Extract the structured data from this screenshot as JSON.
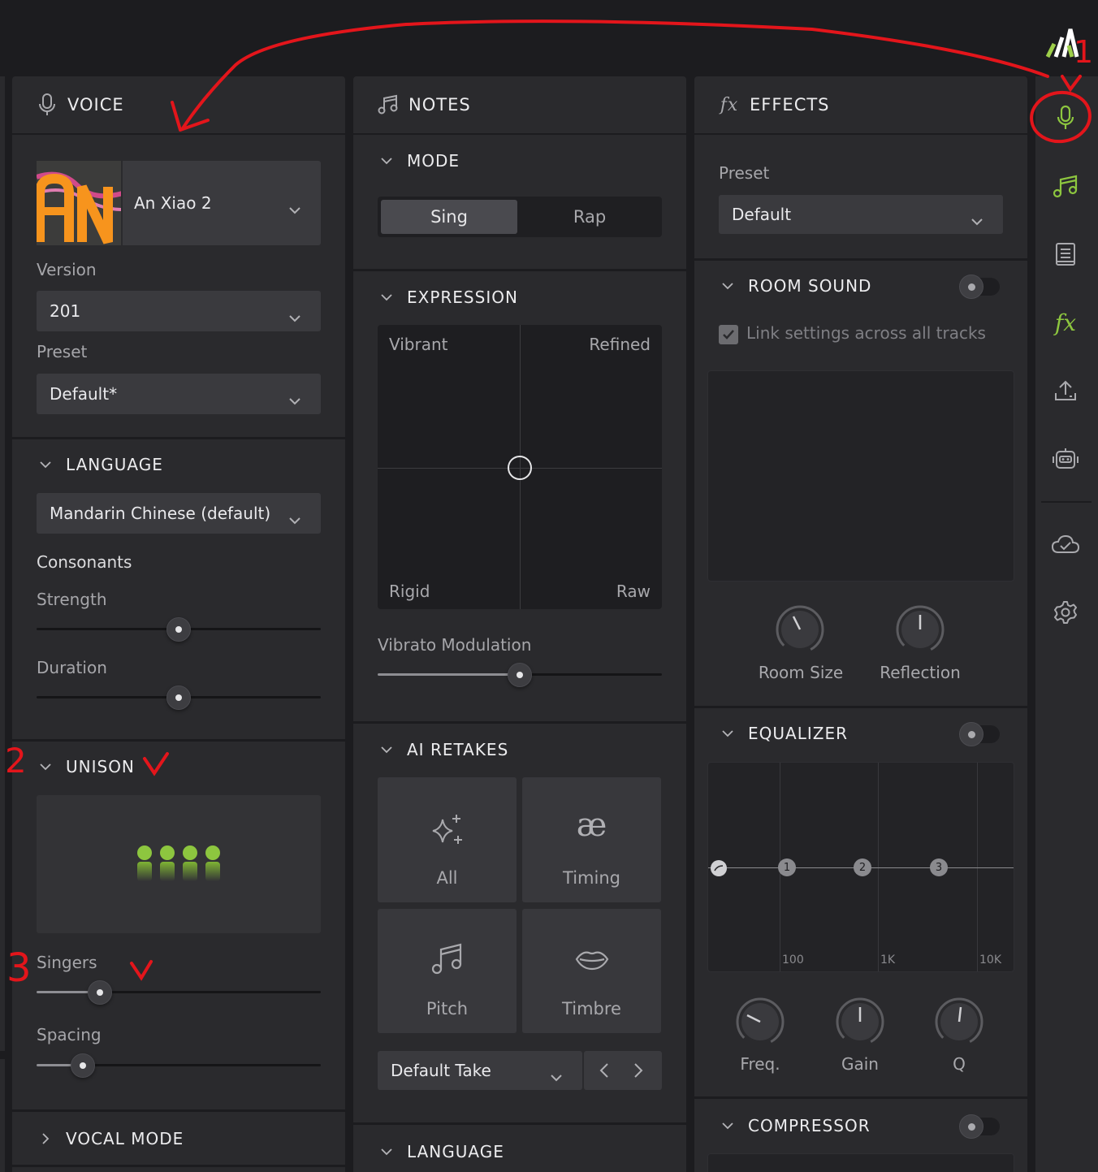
{
  "voice": {
    "header": "VOICE",
    "voice_name": "An Xiao 2",
    "avatar_text": "AN",
    "version_label": "Version",
    "version_value": "201",
    "preset_label": "Preset",
    "preset_value": "Default*",
    "language_section": "LANGUAGE",
    "language_value": "Mandarin Chinese (default)",
    "consonants_label": "Consonants",
    "strength_label": "Strength",
    "strength_value": 0.5,
    "duration_label": "Duration",
    "duration_value": 0.5,
    "unison_section": "UNISON",
    "singers_label": "Singers",
    "singers_value": 0.22,
    "spacing_label": "Spacing",
    "spacing_value": 0.16,
    "vocal_mode_section": "VOCAL MODE"
  },
  "notes": {
    "header": "NOTES",
    "mode_section": "MODE",
    "mode_options": [
      "Sing",
      "Rap"
    ],
    "mode_selected": "Sing",
    "expression_section": "EXPRESSION",
    "pad_labels": {
      "top_left": "Vibrant",
      "top_right": "Refined",
      "bottom_left": "Rigid",
      "bottom_right": "Raw"
    },
    "vibrato_label": "Vibrato Modulation",
    "vibrato_value": 0.5,
    "retakes_section": "AI RETAKES",
    "retakes": [
      {
        "label": "All",
        "icon": "sparkle-icon"
      },
      {
        "label": "Timing",
        "icon": "ae-ligature-icon"
      },
      {
        "label": "Pitch",
        "icon": "music-note-icon"
      },
      {
        "label": "Timbre",
        "icon": "lips-icon"
      }
    ],
    "take_value": "Default Take",
    "language_section": "LANGUAGE"
  },
  "effects": {
    "header": "EFFECTS",
    "preset_label": "Preset",
    "preset_value": "Default",
    "room_section": "ROOM SOUND",
    "link_label": "Link settings across all tracks",
    "room_knobs": [
      "Room Size",
      "Reflection"
    ],
    "eq_section": "EQUALIZER",
    "eq_band_labels": [
      "1",
      "2",
      "3"
    ],
    "eq_freq_labels": [
      "100",
      "1K",
      "10K"
    ],
    "eq_knobs": [
      "Freq.",
      "Gain",
      "Q"
    ],
    "compressor_section": "COMPRESSOR"
  },
  "annotations": [
    "1",
    "2",
    "3"
  ],
  "colors": {
    "accent_green": "#8dc63f",
    "annotation_red": "#e3151b",
    "panel_bg": "#2a2a2d",
    "app_bg": "#1c1c1f"
  },
  "sidebar": [
    "microphone-icon",
    "music-note-icon",
    "book-icon",
    "fx-icon",
    "upload-icon",
    "robot-icon",
    "cloud-check-icon",
    "gear-icon"
  ]
}
